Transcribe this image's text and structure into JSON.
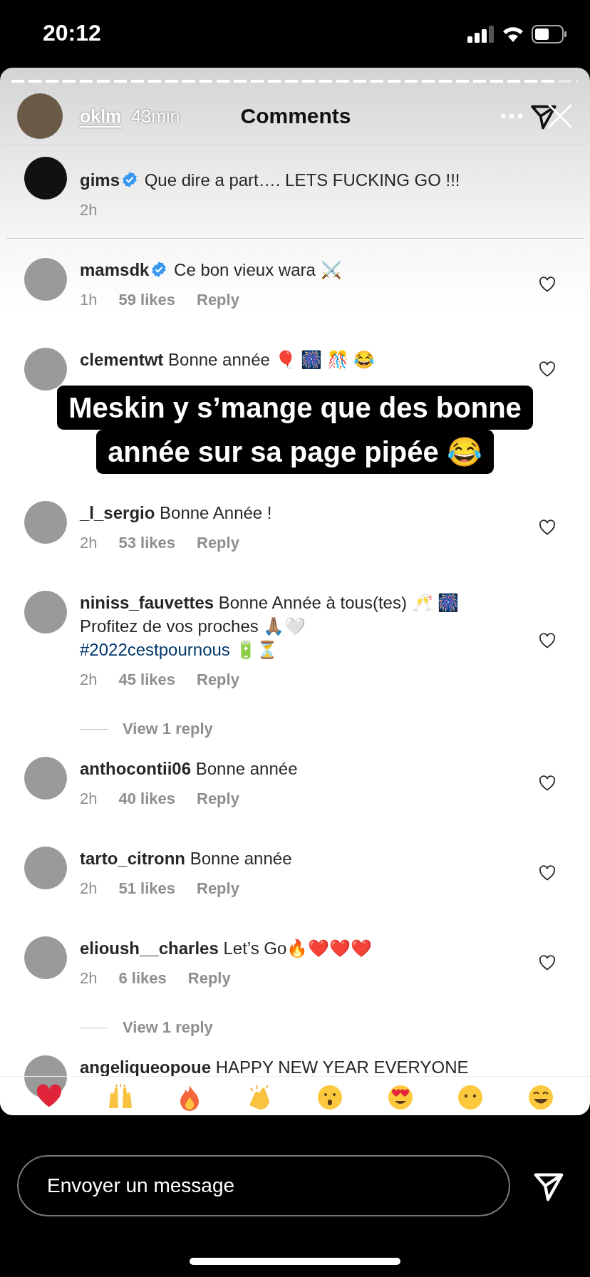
{
  "status_bar": {
    "time": "20:12"
  },
  "story": {
    "progress": {
      "level": 0.96
    },
    "username": "oklm",
    "time": "43min",
    "caption_lines": [
      "Meskin y s’mange que des bonne",
      "année sur sa page pipée 😂"
    ]
  },
  "comments_panel": {
    "title": "Comments",
    "pinned": {
      "username": "gims",
      "verified": true,
      "text": "Que dire a part…. LETS FUCKING GO !!!",
      "time": "2h"
    },
    "comments": [
      {
        "kind": "comment",
        "username": "mamsdk",
        "verified": true,
        "text": "Ce bon vieux wara ⚔️",
        "time": "1h",
        "likes": "59 likes",
        "reply": "Reply",
        "liked": false
      },
      {
        "kind": "comment",
        "username": "clementwt",
        "verified": false,
        "text": "Bonne année 🎈 🎆 🎊 😂",
        "liked": false
      },
      {
        "kind": "comment",
        "username": "_l_sergio",
        "verified": false,
        "text": "Bonne Année !",
        "time": "2h",
        "likes": "53 likes",
        "reply": "Reply",
        "liked": false
      },
      {
        "kind": "comment",
        "username": "niniss_fauvettes",
        "verified": false,
        "text": "Bonne Année à tous(tes) 🥂 🎆\nProfitez de vos proches 🙏🏽🤍\n",
        "hashtag": "#2022cestpournous",
        "text_after": " 🔋⏳",
        "time": "2h",
        "likes": "45 likes",
        "reply": "Reply",
        "liked": false
      },
      {
        "kind": "view_replies",
        "label": "View 1 reply"
      },
      {
        "kind": "comment",
        "username": "anthocontii06",
        "verified": false,
        "text": "Bonne année",
        "time": "2h",
        "likes": "40 likes",
        "reply": "Reply",
        "liked": false
      },
      {
        "kind": "comment",
        "username": "tarto_citronn",
        "verified": false,
        "text": "Bonne année",
        "time": "2h",
        "likes": "51 likes",
        "reply": "Reply",
        "liked": false
      },
      {
        "kind": "comment",
        "username": "elioush__charles",
        "verified": false,
        "text": "Let’s Go🔥❤️❤️❤️",
        "time": "2h",
        "likes": "6 likes",
        "reply": "Reply",
        "liked": false
      },
      {
        "kind": "view_replies",
        "label": "View 1 reply"
      },
      {
        "kind": "comment",
        "username": "angeliqueopoue",
        "verified": false,
        "text": "HAPPY NEW YEAR EVERYONE"
      }
    ]
  },
  "message_field": {
    "placeholder": "Envoyer un message"
  }
}
